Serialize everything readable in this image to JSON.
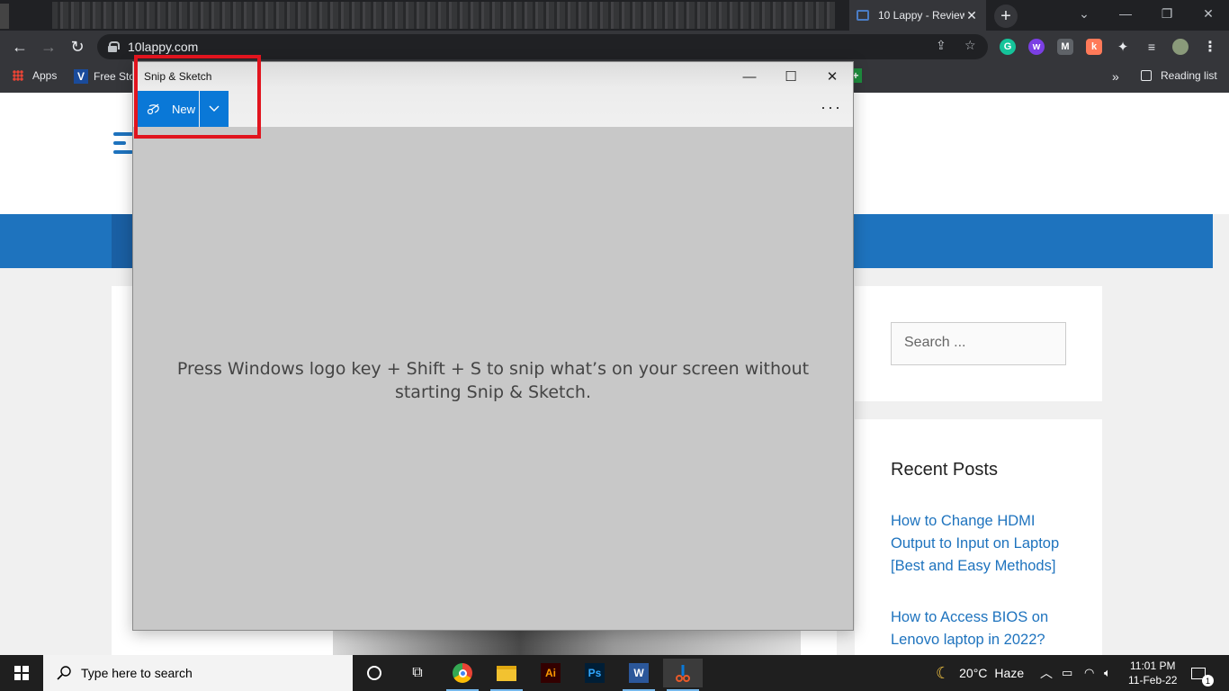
{
  "browser": {
    "tab_title": "10 Lappy - Review",
    "url": "10lappy.com",
    "new_tab_label": "+",
    "bookmarks": {
      "apps": "Apps",
      "free_stock": "Free Sto",
      "reading_list": "Reading list",
      "overflow": "»"
    },
    "extensions": [
      {
        "name": "grammarly",
        "letter": "G",
        "color": "#15c39a"
      },
      {
        "name": "wordtune",
        "letter": "w",
        "color": "#7b3fe4"
      },
      {
        "name": "gmail-m",
        "letter": "M",
        "color": "#5f6368"
      },
      {
        "name": "hubspot",
        "letter": "k",
        "color": "#ff7a59"
      }
    ]
  },
  "website": {
    "search_placeholder": "Search ...",
    "recent_posts_title": "Recent Posts",
    "recent_posts": [
      "How to Change HDMI Output to Input on Laptop [Best and Easy Methods]",
      "How to Access BIOS on Lenovo laptop in 2022?"
    ]
  },
  "snip_sketch": {
    "title": "Snip & Sketch",
    "new_label": "New",
    "more_label": "···",
    "message": "Press Windows logo key + Shift + S to snip what’s on your screen without starting Snip & Sketch."
  },
  "taskbar": {
    "search_placeholder": "Type here to search",
    "weather_temp": "20°C",
    "weather_desc": "Haze",
    "time": "11:01 PM",
    "date": "11-Feb-22",
    "notification_count": "1",
    "apps": [
      {
        "name": "chrome",
        "label": ""
      },
      {
        "name": "file-explorer",
        "label": ""
      },
      {
        "name": "illustrator",
        "label": "Ai"
      },
      {
        "name": "photoshop",
        "label": "Ps"
      },
      {
        "name": "word",
        "label": "W"
      },
      {
        "name": "snip-sketch",
        "label": ""
      }
    ]
  },
  "colors": {
    "accent_blue": "#0a78d7",
    "highlight_red": "#e1141e",
    "site_blue": "#1e73be"
  }
}
